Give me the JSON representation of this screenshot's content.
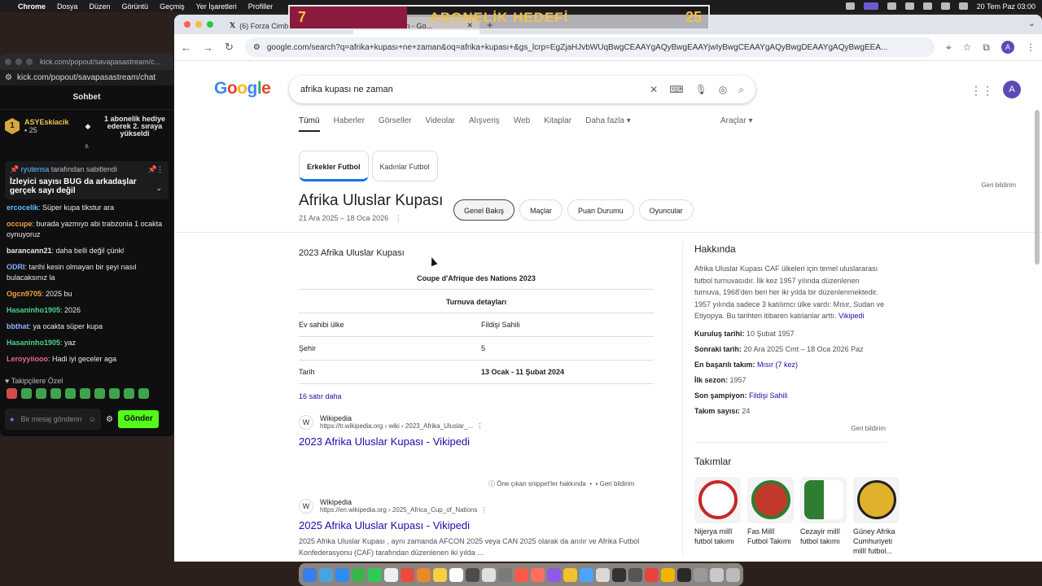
{
  "menubar": {
    "app": "Chrome",
    "items": [
      "Dosya",
      "Düzen",
      "Görüntü",
      "Geçmiş",
      "Yer İşaretleri",
      "Profiller"
    ],
    "clock": "20 Tem Paz  03:00"
  },
  "goal": {
    "current": "7",
    "title": "ABONELİK HEDEFİ",
    "target": "25",
    "fill_fraction": 0.28,
    "fill_color": "#8b1a3f",
    "text_color": "#f3c04a"
  },
  "chat": {
    "window_url": "kick.com/popout/savapasastream/c...",
    "address": "kick.com/popout/savapasastream/chat",
    "header": "Sohbet",
    "sub_banner": {
      "rank": "1",
      "user": "ASYEskiacik",
      "count": "25",
      "message": "1 abonelik hediye ederek 2. sıraya yükseldi"
    },
    "pinned": {
      "user": "ryutensa",
      "by_text": "tarafından sabitlendi",
      "text": "İzleyici sayısı BUG da arkadaşlar gerçek sayı değil"
    },
    "messages": [
      {
        "user": "ercocelik",
        "color": "#5bc1ff",
        "text": ": Süper kupa tikstur ara"
      },
      {
        "user": "occupe",
        "color": "#f2a33a",
        "text": ": burada yazmıyo abi trabzonia 1 ocakta oynuyoruz"
      },
      {
        "user": "barancann21",
        "color": "#e9e9e9",
        "text": ": daha belli değil çünkl"
      },
      {
        "user": "ODRI",
        "color": "#7fb2ff",
        "text": ": tarihi kesin olmayan bir şeyi nasıl bulacaksınız la"
      },
      {
        "user": "Ogcn9705",
        "color": "#f2a33a",
        "text": ": 2025 bu"
      },
      {
        "user": "Hasaninho1905",
        "color": "#4fd18b",
        "text": ": 2026"
      },
      {
        "user": "bbthat",
        "color": "#8fb4ff",
        "text": ": ya ocakta süper kupa"
      },
      {
        "user": "Hasaninho1905",
        "color": "#4fd18b",
        "text": ": yaz"
      },
      {
        "user": "Leroyyiiooo",
        "color": "#e46a8a",
        "text": ": Hadi iyi geceler aga"
      }
    ],
    "follower_label": "Takipçilere Özel",
    "input_placeholder": "Bir mesaj gönderin",
    "send_label": "Gönder"
  },
  "browser": {
    "tabs": [
      {
        "title": "(6) Forza Cimb..."
      },
      {
        "title": "...ası ne zaman - Go..."
      }
    ],
    "url": "google.com/search?q=afrika+kupası+ne+zaman&oq=afrika+kupası+&gs_lcrp=EgZjaHJvbWUqBwgCEAAYgAQyBwgEAAYjwIyBwgCEAAYgAQyBwgDEAAYgAQyBwgEEA...",
    "profile_initial": "A"
  },
  "google": {
    "query": "afrika kupası ne zaman",
    "nav": [
      "Tümü",
      "Haberler",
      "Görseller",
      "Videolar",
      "Alışveriş",
      "Web",
      "Kitaplar",
      "Daha fazla"
    ],
    "tools": "Araçlar",
    "sport_tabs": [
      "Erkekler Futbol",
      "Kadınlar Futbol"
    ],
    "feedback": "Geri bildirim",
    "entity": {
      "title": "Afrika Uluslar Kupası",
      "dates": "21 Ara 2025 – 18 Oca 2026",
      "pills": [
        "Genel Bakış",
        "Maçlar",
        "Puan Durumu",
        "Oyuncular"
      ]
    },
    "infobox": {
      "heading": "2023 Afrika Uluslar Kupası",
      "title": "Coupe d'Afrique des Nations 2023",
      "subtitle": "Turnuva detayları",
      "rows": [
        {
          "k": "Ev sahibi ülke",
          "v": "Fildişi Sahili"
        },
        {
          "k": "Şehir",
          "v": "5"
        },
        {
          "k": "Tarih",
          "v": "13 Ocak - 11 Şubat 2024"
        }
      ],
      "more": "16 satır daha"
    },
    "results": [
      {
        "site": "Wikipedia",
        "url": "https://tr.wikipedia.org › wiki › 2023_Afrika_Uluslar_...",
        "title": "2023 Afrika Uluslar Kupası - Vikipedi",
        "snippet": ""
      },
      {
        "site": "Wikipedia",
        "url": "https://en.wikipedia.org › 2025_Africa_Cup_of_Nations",
        "title": "2025 Afrika Uluslar Kupası - Vikipedi",
        "snippet": "2025 Afrika Uluslar Kupası , aynı zamanda AFCON 2025 veya CAN 2025 olarak da anılır ve Afrika Futbol Konfederasyonu (CAF) tarafından düzenlenen iki yılda ..."
      }
    ],
    "snippet_about": "Öne çıkan snippet'ler hakkında",
    "snippet_feedback": "Geri bildirim",
    "kp": {
      "heading": "Hakkında",
      "desc": "Afrika Uluslar Kupası CAF ülkeleri için temel uluslararası futbol turnuvasıdır. İlk kez 1957 yılında düzenlenen turnuva, 1968'den beri her iki yılda bir düzenlenmektedir. 1957 yılında sadece 3 katılımcı ülke vardı: Mısır, Sudan ve Etiyopya. Bu tarihten itibaren katılanlar arttı.",
      "desc_link": "Vikipedi",
      "facts": [
        {
          "k": "Kuruluş tarihi:",
          "v": "10 Şubat 1957",
          "link": false
        },
        {
          "k": "Sonraki tarih:",
          "v": "20 Ara 2025 Cmt – 18 Oca 2026 Paz",
          "link": false
        },
        {
          "k": "En başarılı takım:",
          "v": "Mısır (7 kez)",
          "link": true
        },
        {
          "k": "İlk sezon:",
          "v": "1957",
          "link": false
        },
        {
          "k": "Son şampiyon:",
          "v": "Fildişi Sahili",
          "link": true
        },
        {
          "k": "Takım sayısı:",
          "v": "24",
          "link": false
        }
      ],
      "feedback": "Geri bildirim",
      "teams_heading": "Takımlar",
      "teams": [
        {
          "name": "Nijerya millî futbol takımı",
          "color": "#c62828"
        },
        {
          "name": "Fas Millî Futbol Takımı",
          "color": "#c0392b"
        },
        {
          "name": "Cezayir millî futbol takımı",
          "color": "#2e7d32"
        },
        {
          "name": "Güney Afrika Cumhuriyeti millî futbol...",
          "color": "#e1b12c"
        }
      ]
    }
  }
}
